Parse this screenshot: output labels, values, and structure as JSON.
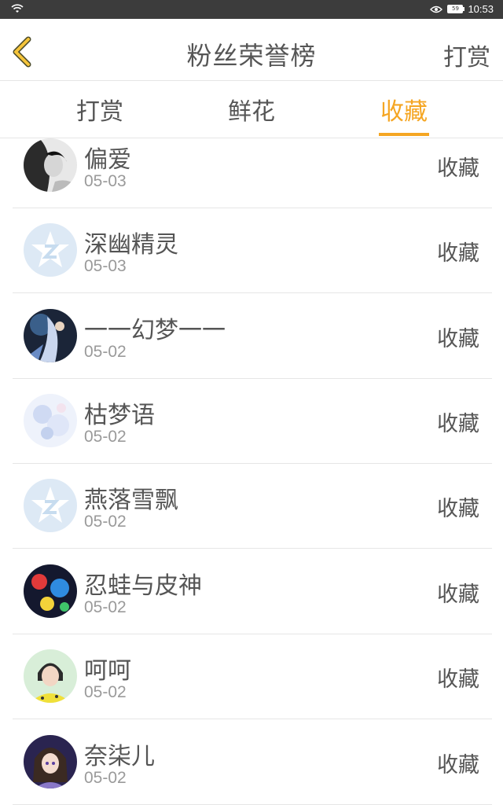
{
  "status_bar": {
    "time": "10:53",
    "battery": "59"
  },
  "header": {
    "title": "粉丝荣誉榜",
    "action": "打赏"
  },
  "tabs": [
    {
      "label": "打赏",
      "active": false
    },
    {
      "label": "鲜花",
      "active": false
    },
    {
      "label": "收藏",
      "active": true
    }
  ],
  "colors": {
    "accent": "#f5a623",
    "text": "#555555",
    "subtext": "#9a9a9a"
  },
  "list": [
    {
      "name": "偏爱",
      "date": "05-03",
      "action": "收藏",
      "avatar": "photo-grayscale"
    },
    {
      "name": "深幽精灵",
      "date": "05-03",
      "action": "收藏",
      "avatar": "default-qq"
    },
    {
      "name": "一一幻梦一一",
      "date": "05-02",
      "action": "收藏",
      "avatar": "photo-anime-dark"
    },
    {
      "name": "枯梦语",
      "date": "05-02",
      "action": "收藏",
      "avatar": "photo-pastel"
    },
    {
      "name": "燕落雪飘",
      "date": "05-02",
      "action": "收藏",
      "avatar": "default-qq"
    },
    {
      "name": "忍蛙与皮神",
      "date": "05-02",
      "action": "收藏",
      "avatar": "photo-colorful"
    },
    {
      "name": "呵呵",
      "date": "05-02",
      "action": "收藏",
      "avatar": "photo-girl-yellow"
    },
    {
      "name": "奈柒儿",
      "date": "05-02",
      "action": "收藏",
      "avatar": "photo-anime-girl"
    }
  ]
}
